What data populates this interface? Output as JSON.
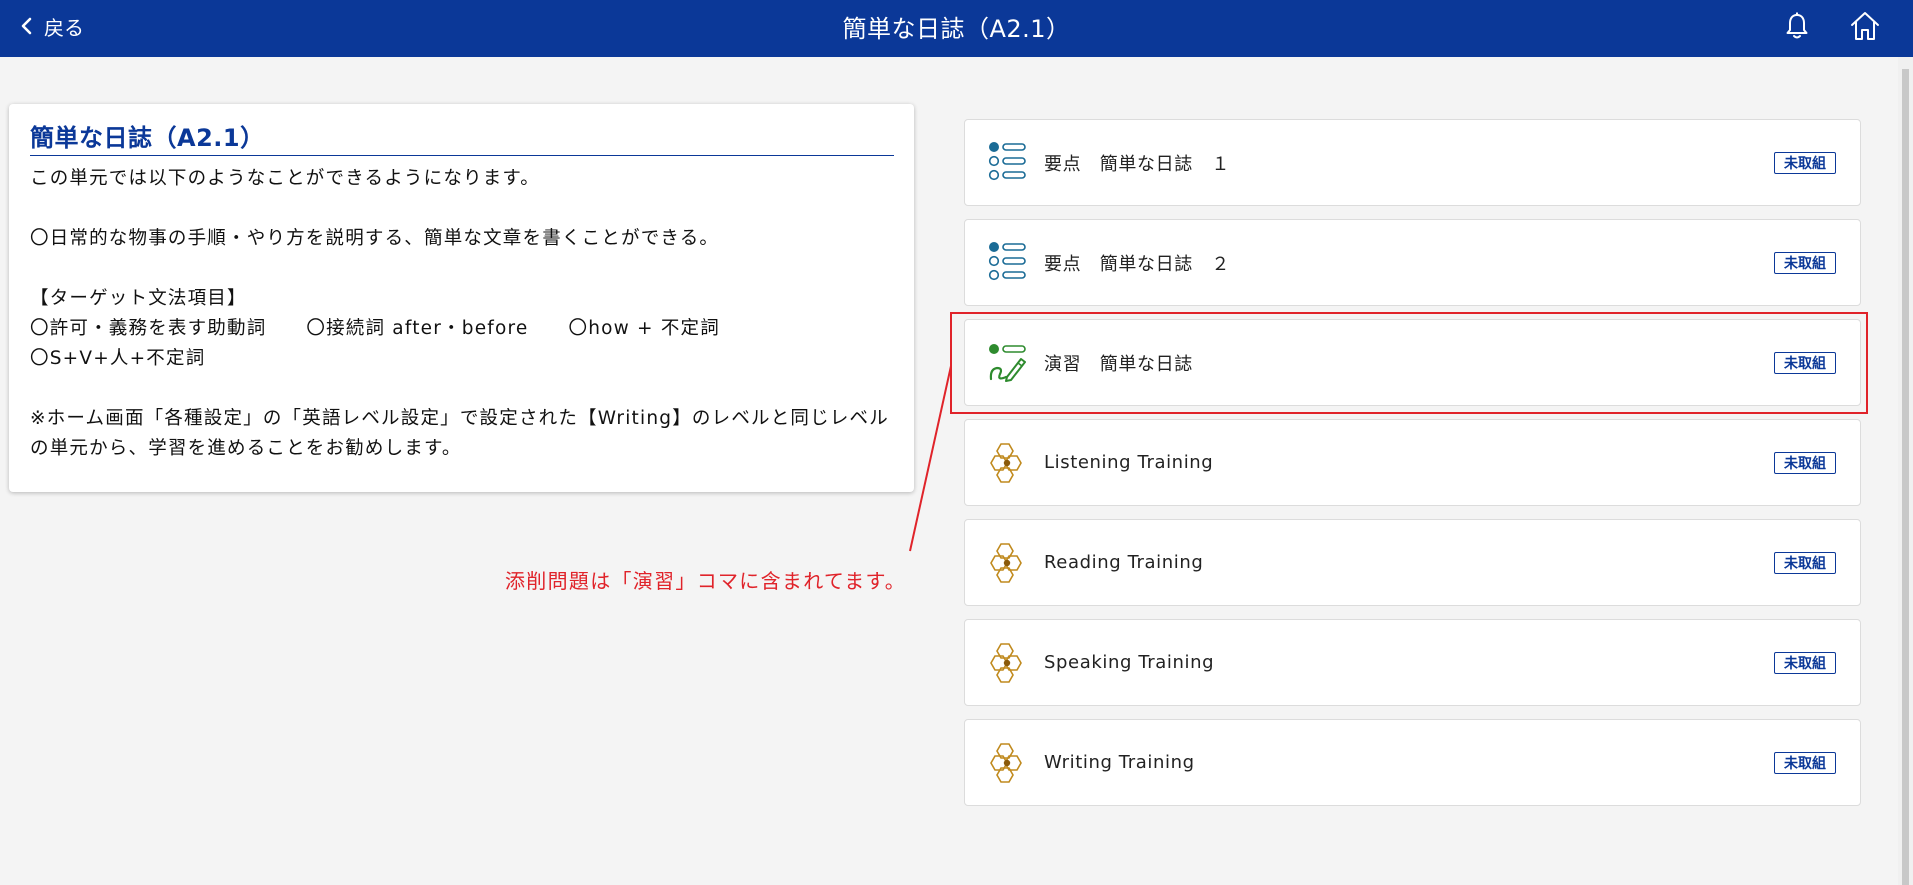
{
  "colors": {
    "header": "#0b3898",
    "accent": "#0b3898",
    "annotation": "#e0232a",
    "points_icon": "#1a6b96",
    "practice_icon": "#2e8b2e",
    "training_icon": "#c08a1e"
  },
  "header": {
    "back_label": "戻る",
    "back_icon": "chevron-left-icon",
    "title": "簡単な日誌（A2.1）",
    "bell_icon": "bell-icon",
    "home_icon": "home-icon"
  },
  "info": {
    "title": "簡単な日誌（A2.1）",
    "intro": "この単元では以下のようなことができるようになります。",
    "goal": "〇日常的な物事の手順・やり方を説明する、簡単な文章を書くことができる。",
    "grammar_heading": "【ターゲット文法項目】",
    "grammar_items": [
      "〇許可・義務を表す助動詞",
      "〇接続詞 after・before",
      "〇how + 不定詞",
      "〇S+V+人+不定詞"
    ],
    "note": "※ホーム画面「各種設定」の「英語レベル設定」で設定された【Writing】のレベルと同じレベルの単元から、学習を進めることをお勧めします。"
  },
  "annotation": "添削問題は「演習」コマに含まれてます。",
  "units": [
    {
      "label": "要点　簡単な日誌　１",
      "status": "未取組",
      "icon": "key-points-list-icon"
    },
    {
      "label": "要点　簡単な日誌　２",
      "status": "未取組",
      "icon": "key-points-list-icon"
    },
    {
      "label": "演習　簡単な日誌",
      "status": "未取組",
      "icon": "practice-pencil-icon"
    },
    {
      "label": "Listening Training",
      "status": "未取組",
      "icon": "training-hexagon-icon"
    },
    {
      "label": "Reading Training",
      "status": "未取組",
      "icon": "training-hexagon-icon"
    },
    {
      "label": "Speaking Training",
      "status": "未取組",
      "icon": "training-hexagon-icon"
    },
    {
      "label": "Writing Training",
      "status": "未取組",
      "icon": "training-hexagon-icon"
    }
  ]
}
